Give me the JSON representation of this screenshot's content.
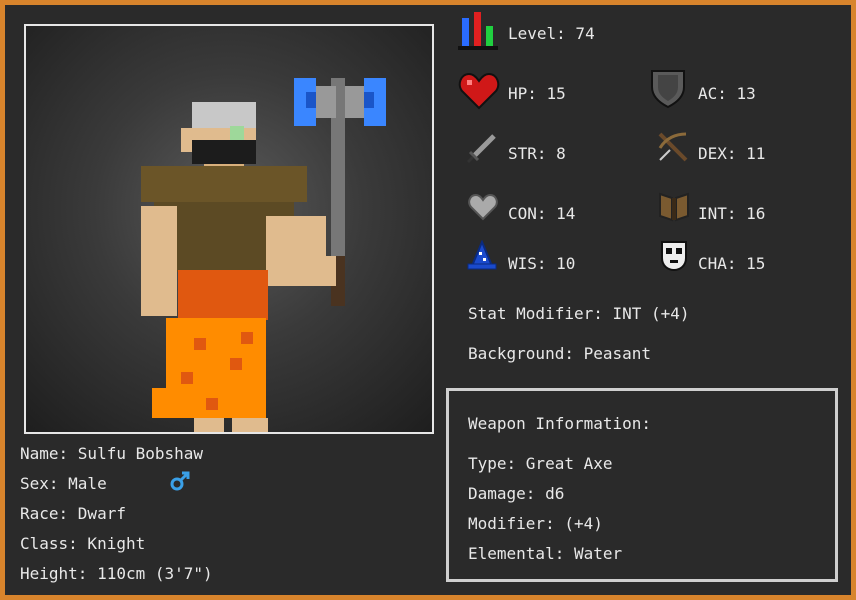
{
  "character": {
    "name_line": "Name: Sulfu Bobshaw",
    "sex_line": "Sex: Male",
    "race_line": "Race: Dwarf",
    "class_line": "Class: Knight",
    "height_line": "Height: 110cm (3'7\")"
  },
  "stats": {
    "level": "Level: 74",
    "hp": "HP: 15",
    "ac": "AC: 13",
    "str": "STR: 8",
    "dex": "DEX: 11",
    "con": "CON: 14",
    "int": "INT: 16",
    "wis": "WIS: 10",
    "cha": "CHA: 15"
  },
  "modifier_line": "Stat Modifier: INT (+4)",
  "background_line": "Background: Peasant",
  "weapon": {
    "heading": "Weapon Information:",
    "type_line": "Type: Great Axe",
    "damage_line": "Damage: d6",
    "modifier_line": "Modifier: (+4)",
    "elemental_line": "Elemental: Water"
  },
  "icons": {
    "level": "level-bars-icon",
    "hp": "heart-icon",
    "ac": "shield-icon",
    "str": "sword-icon",
    "dex": "crossbow-icon",
    "con": "grey-heart-icon",
    "int": "book-icon",
    "wis": "wizard-hat-icon",
    "cha": "mask-icon",
    "sex": "male-symbol-icon"
  },
  "colors": {
    "border": "#d8842c",
    "panel": "#2a2a2a",
    "text": "#e8e8e8",
    "male_symbol": "#3aa0e8"
  }
}
